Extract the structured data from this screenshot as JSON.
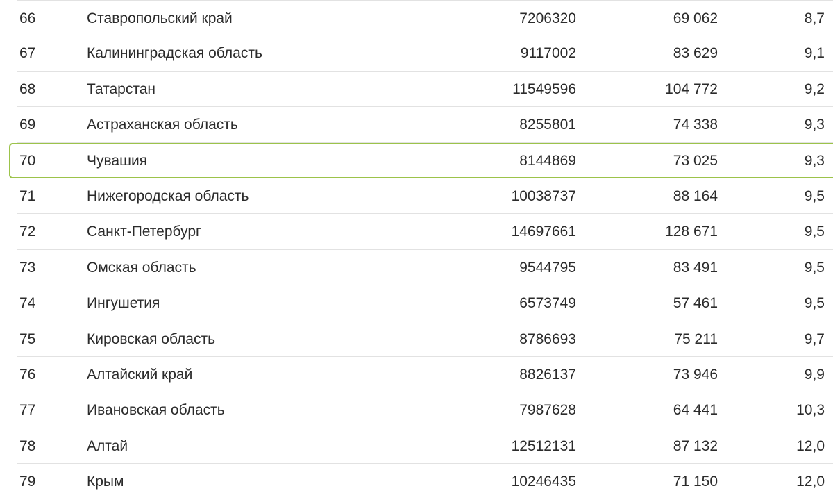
{
  "rows": [
    {
      "rank": "66",
      "region": "Ставропольский край",
      "v1": "7206320",
      "v2": "69 062",
      "v3": "8,7",
      "highlight": false
    },
    {
      "rank": "67",
      "region": "Калининградская область",
      "v1": "9117002",
      "v2": "83 629",
      "v3": "9,1",
      "highlight": false
    },
    {
      "rank": "68",
      "region": "Татарстан",
      "v1": "11549596",
      "v2": "104 772",
      "v3": "9,2",
      "highlight": false
    },
    {
      "rank": "69",
      "region": "Астраханская область",
      "v1": "8255801",
      "v2": "74 338",
      "v3": "9,3",
      "highlight": false
    },
    {
      "rank": "70",
      "region": "Чувашия",
      "v1": "8144869",
      "v2": "73 025",
      "v3": "9,3",
      "highlight": true
    },
    {
      "rank": "71",
      "region": "Нижегородская область",
      "v1": "10038737",
      "v2": "88 164",
      "v3": "9,5",
      "highlight": false
    },
    {
      "rank": "72",
      "region": "Санкт-Петербург",
      "v1": "14697661",
      "v2": "128 671",
      "v3": "9,5",
      "highlight": false
    },
    {
      "rank": "73",
      "region": "Омская область",
      "v1": "9544795",
      "v2": "83 491",
      "v3": "9,5",
      "highlight": false
    },
    {
      "rank": "74",
      "region": "Ингушетия",
      "v1": "6573749",
      "v2": "57 461",
      "v3": "9,5",
      "highlight": false
    },
    {
      "rank": "75",
      "region": "Кировская область",
      "v1": "8786693",
      "v2": "75 211",
      "v3": "9,7",
      "highlight": false
    },
    {
      "rank": "76",
      "region": "Алтайский край",
      "v1": "8826137",
      "v2": "73 946",
      "v3": "9,9",
      "highlight": false
    },
    {
      "rank": "77",
      "region": "Ивановская область",
      "v1": "7987628",
      "v2": "64 441",
      "v3": "10,3",
      "highlight": false
    },
    {
      "rank": "78",
      "region": "Алтай",
      "v1": "12512131",
      "v2": "87 132",
      "v3": "12,0",
      "highlight": false
    },
    {
      "rank": "79",
      "region": "Крым",
      "v1": "10246435",
      "v2": "71 150",
      "v3": "12,0",
      "highlight": false
    }
  ],
  "colors": {
    "highlight_border": "#9cc34a",
    "row_divider": "#e2e2e2",
    "text": "#2b2b2b"
  }
}
